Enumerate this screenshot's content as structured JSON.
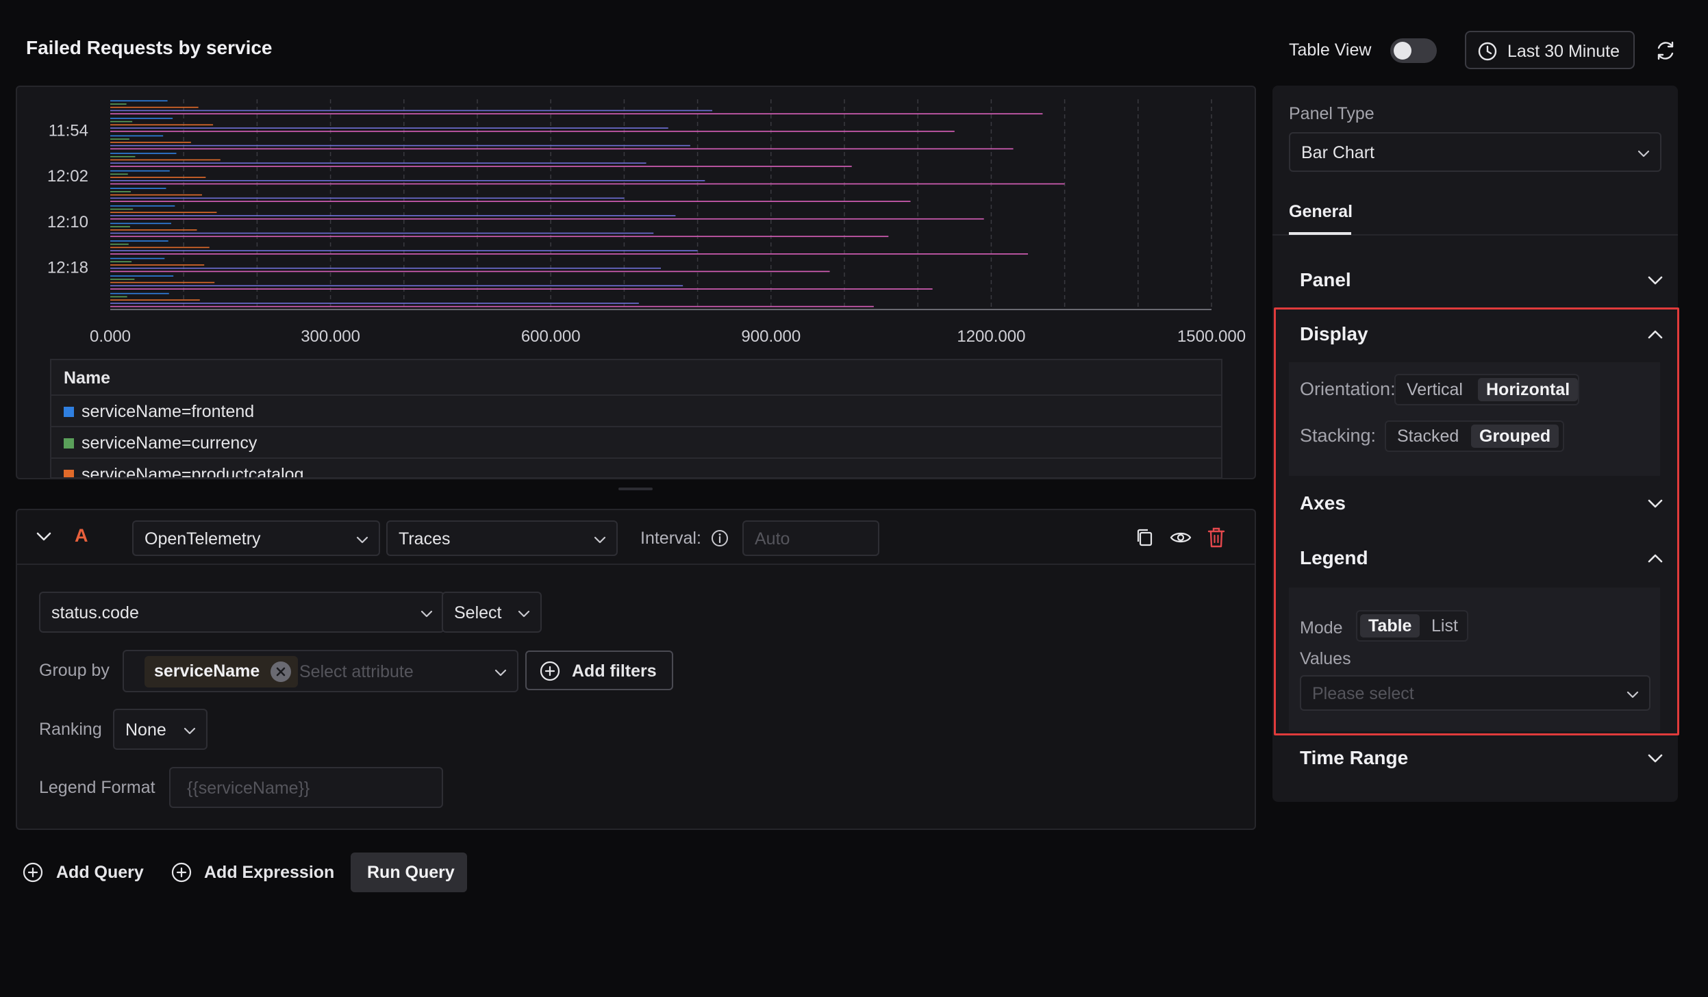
{
  "header": {
    "title": "Failed Requests by service",
    "table_view_label": "Table View",
    "time_range": "Last 30 Minute"
  },
  "chart_data": {
    "type": "bar",
    "orientation": "horizontal",
    "stacking": "grouped",
    "title": "",
    "xlabel": "",
    "ylabel": "",
    "y_ticks": [
      "11:54",
      "12:02",
      "12:10",
      "12:18"
    ],
    "x_ticks": [
      "0.000",
      "300.000",
      "600.000",
      "900.000",
      "1200.000",
      "1500.000"
    ],
    "xlim": [
      0,
      1500
    ],
    "grid": "vertical",
    "series": [
      {
        "name": "serviceName=frontend",
        "color": "#2f7fe0",
        "values": [
          78,
          85,
          72,
          90,
          81,
          76,
          88,
          83,
          79,
          74,
          86,
          80
        ]
      },
      {
        "name": "serviceName=currency",
        "color": "#5aa05a",
        "values": [
          22,
          30,
          26,
          34,
          24,
          28,
          31,
          27,
          25,
          29,
          33,
          23
        ]
      },
      {
        "name": "serviceName=productcatalog",
        "color": "#e06a2a",
        "values": [
          120,
          140,
          110,
          150,
          130,
          125,
          145,
          118,
          135,
          128,
          142,
          122
        ]
      },
      {
        "name": "",
        "color": "#6f6fd6",
        "values": [
          820,
          760,
          790,
          730,
          810,
          700,
          770,
          740,
          800,
          750,
          780,
          720
        ]
      },
      {
        "name": "",
        "color": "#d65fb8",
        "values": [
          1270,
          1150,
          1230,
          1010,
          1300,
          1090,
          1190,
          1060,
          1250,
          980,
          1120,
          1040
        ]
      }
    ]
  },
  "legend": {
    "header": "Name",
    "rows": [
      {
        "label": "serviceName=frontend",
        "color": "#2f7fe0"
      },
      {
        "label": "serviceName=currency",
        "color": "#5aa05a"
      },
      {
        "label": "serviceName=productcatalog",
        "color": "#e06a2a"
      }
    ]
  },
  "query": {
    "letter": "A",
    "datasource": "OpenTelemetry",
    "signal": "Traces",
    "interval_label": "Interval:",
    "interval_placeholder": "Auto",
    "metric": "status.code",
    "aggregate": "Select",
    "group_by_label": "Group by",
    "group_by_chip": "serviceName",
    "group_by_placeholder": "Select attribute",
    "add_filters": "Add filters",
    "ranking_label": "Ranking",
    "ranking_value": "None",
    "legend_format_label": "Legend Format",
    "legend_format_placeholder": "{{serviceName}}"
  },
  "actions": {
    "add_query": "Add Query",
    "add_expression": "Add Expression",
    "run_query": "Run Query"
  },
  "settings": {
    "panel_type_label": "Panel Type",
    "panel_type_value": "Bar Chart",
    "tab_general": "General",
    "section_panel": "Panel",
    "section_display": "Display",
    "orientation_label": "Orientation:",
    "orientation_options": [
      "Vertical",
      "Horizontal"
    ],
    "orientation_selected": "Horizontal",
    "stacking_label": "Stacking:",
    "stacking_options": [
      "Stacked",
      "Grouped"
    ],
    "stacking_selected": "Grouped",
    "section_axes": "Axes",
    "section_legend": "Legend",
    "mode_label": "Mode",
    "mode_options": [
      "Table",
      "List"
    ],
    "mode_selected": "Table",
    "values_label": "Values",
    "values_placeholder": "Please select",
    "section_time_range": "Time Range"
  },
  "colors": {
    "highlight": "#e03b3b",
    "danger": "#e5484d",
    "accent_letter": "#e8603c"
  }
}
